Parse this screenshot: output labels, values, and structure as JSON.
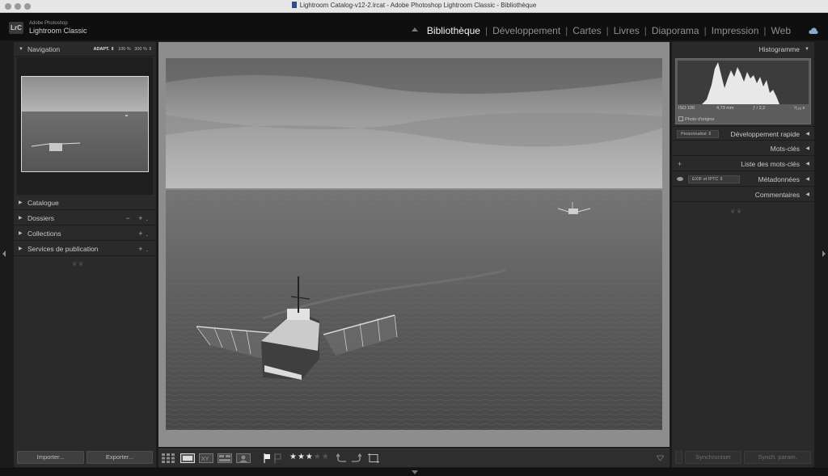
{
  "window": {
    "title": "Lightroom Catalog-v12-2.lrcat - Adobe Photoshop Lightroom Classic - Bibliothèque"
  },
  "identity": {
    "badge": "LrC",
    "line1": "Adobe Photoshop",
    "line2": "Lightroom Classic"
  },
  "modules": [
    {
      "label": "Bibliothèque",
      "active": true
    },
    {
      "label": "Développement",
      "active": false
    },
    {
      "label": "Cartes",
      "active": false
    },
    {
      "label": "Livres",
      "active": false
    },
    {
      "label": "Diaporama",
      "active": false
    },
    {
      "label": "Impression",
      "active": false
    },
    {
      "label": "Web",
      "active": false
    }
  ],
  "left_panel": {
    "navigation": {
      "label": "Navigation",
      "opt_adapt": "ADAPT. ⇕",
      "opt_100": "100 %",
      "opt_300": "300 % ⇕"
    },
    "sections": [
      {
        "label": "Catalogue",
        "actions": ""
      },
      {
        "label": "Dossiers",
        "actions": "− +."
      },
      {
        "label": "Collections",
        "actions": "+."
      },
      {
        "label": "Services de publication",
        "actions": "+."
      }
    ],
    "import_label": "Importer...",
    "export_label": "Exporter..."
  },
  "right_panel": {
    "histogram": {
      "label": "Histogramme",
      "iso": "ISO 100",
      "focal": "4,73 mm",
      "aperture": "ƒ / 2,2",
      "shutter": "¹⁄₁₂₈ s",
      "original_label": "Photo d'origine"
    },
    "quick_develop": {
      "label": "Développement rapide",
      "preset": "Personnalisé"
    },
    "keywords": {
      "label": "Mots-clés"
    },
    "keyword_list": {
      "label": "Liste des mots-clés"
    },
    "metadata": {
      "label": "Métadonnées",
      "preset": "EXIF et IPTC"
    },
    "comments": {
      "label": "Commentaires"
    },
    "sync_label": "Synchroniser",
    "sync_params_label": "Synch. param."
  },
  "toolbar": {
    "rating": 3,
    "rating_max": 5,
    "stars_on": "★★★",
    "stars_off": "★★"
  },
  "colors": {
    "panel_bg": "#2a2a2a",
    "app_bg": "#1b1b1b",
    "active_module": "#f2f2f2",
    "inactive_module": "#8f8f8f"
  }
}
